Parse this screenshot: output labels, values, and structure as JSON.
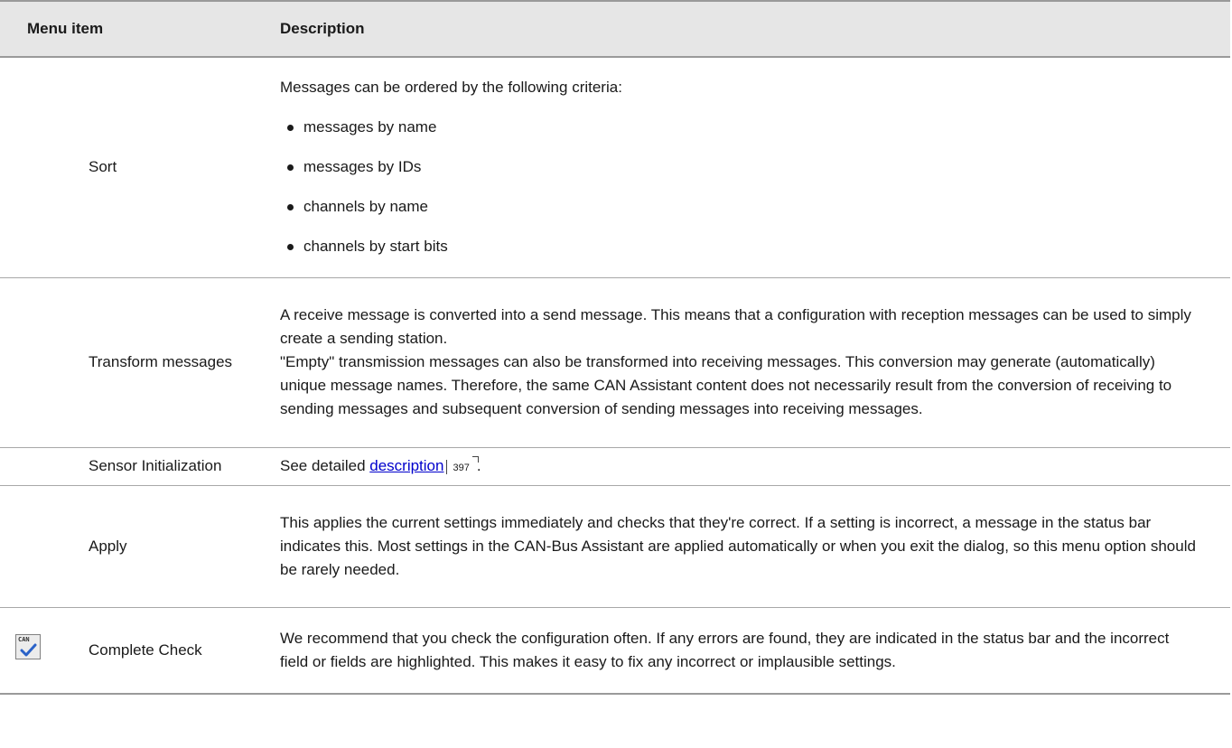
{
  "header": {
    "menu_item": "Menu item",
    "description": "Description"
  },
  "rows": [
    {
      "item": "Sort",
      "intro": "Messages can be ordered by the following criteria:",
      "bullets": [
        "messages by name",
        "messages by IDs",
        "channels by name",
        "channels by start bits"
      ]
    },
    {
      "item": "Transform messages",
      "desc_1": "A receive message is converted into a send message. This means that a configuration with reception messages can be used to simply create a sending station.",
      "desc_2": "\"Empty\" transmission messages can also be transformed into receiving messages. This conversion may generate (automatically) unique message names. Therefore, the same CAN Assistant content does not necessarily result from the conversion of receiving to sending messages and subsequent conversion of sending messages into receiving messages."
    },
    {
      "item": "Sensor Initialization",
      "prefix": "See detailed ",
      "link": "description",
      "page_ref": "397",
      "suffix": "."
    },
    {
      "item": "Apply",
      "desc": "This applies the current settings immediately and checks that they're correct. If a setting is incorrect, a message in the status bar indicates this. Most settings in the CAN-Bus Assistant are applied automatically or when you exit the dialog, so this menu option should be rarely needed."
    },
    {
      "item": "Complete Check",
      "icon": "can-check-icon",
      "icon_text": "CAN",
      "desc": "We recommend that you check the configuration often. If any errors are found, they are indicated in the status bar and the incorrect field or fields are highlighted. This makes it easy to fix any incorrect or implausible settings."
    }
  ],
  "colors": {
    "header_bg": "#e6e6e6",
    "link": "#0000cc",
    "check_mark": "#2a62c8"
  }
}
